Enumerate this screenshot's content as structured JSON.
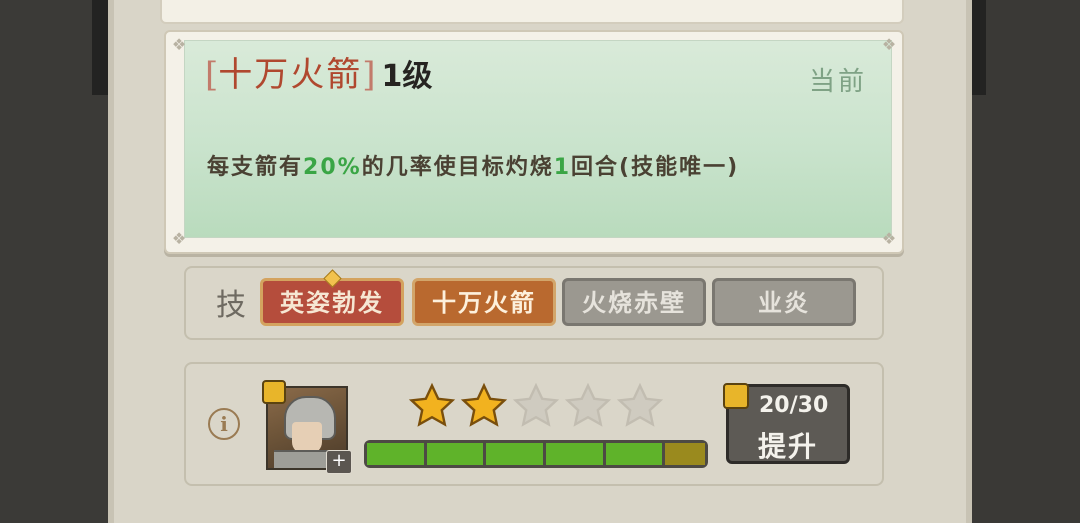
{
  "skill_detail": {
    "bracket_open": "[",
    "name": "十万火箭",
    "bracket_close": "]",
    "level": "1级",
    "status": "当前",
    "description_parts": [
      "每支箭有",
      "20%",
      "的几率使目标灼烧",
      "1",
      "回合(技能唯一)"
    ]
  },
  "skills": {
    "label": "技",
    "tabs": [
      {
        "label": "英姿勃发",
        "state": "selected",
        "color": "#b54d3c"
      },
      {
        "label": "十万火箭",
        "state": "active",
        "color": "#b9692f"
      },
      {
        "label": "火烧赤壁",
        "state": "locked",
        "color": "#9b9890"
      },
      {
        "label": "业炎",
        "state": "locked",
        "color": "#9b9890"
      }
    ]
  },
  "hero": {
    "info_icon": "i",
    "portrait_icon": "hero-portrait",
    "plus_label": "+",
    "stars_filled": 2,
    "stars_total": 5,
    "star_color": "#f2b21f",
    "progress_segments_filled": 5,
    "progress_segment_partial": true,
    "progress_segments_total": 6,
    "progress_color": "#5fb32a",
    "progress_partial_color": "#9a8a1e",
    "upgrade": {
      "count": "20/30",
      "label": "提升"
    }
  }
}
